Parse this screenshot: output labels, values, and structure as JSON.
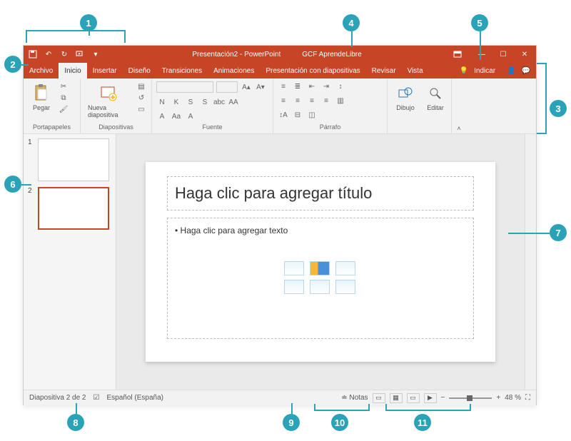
{
  "title": {
    "doc": "Presentación2",
    "app": "PowerPoint",
    "account": "GCF AprendeLibre"
  },
  "tabs": [
    "Archivo",
    "Inicio",
    "Insertar",
    "Diseño",
    "Transiciones",
    "Animaciones",
    "Presentación con diapositivas",
    "Revisar",
    "Vista"
  ],
  "tell_me": "Indicar",
  "ribbon": {
    "paste": "Pegar",
    "clipboard": "Portapapeles",
    "new_slide": "Nueva diapositiva",
    "slides": "Diapositivas",
    "font": "Fuente",
    "paragraph": "Párrafo",
    "drawing": "Dibujo",
    "edit": "Editar",
    "font_letters": [
      "N",
      "K",
      "S",
      "S",
      "abc",
      "AA"
    ],
    "font_row2": [
      "A",
      "Aa",
      "A"
    ]
  },
  "thumbs": [
    {
      "num": "1",
      "selected": false
    },
    {
      "num": "2",
      "selected": true
    }
  ],
  "slide": {
    "title_ph": "Haga clic para agregar título",
    "content_ph": "Haga clic para agregar texto"
  },
  "status": {
    "slide_count": "Diapositiva 2 de 2",
    "lang": "Español (España)",
    "notes": "Notas",
    "zoom_pct": "48 %"
  },
  "markers": [
    "1",
    "2",
    "3",
    "4",
    "5",
    "6",
    "7",
    "8",
    "9",
    "10",
    "11"
  ]
}
